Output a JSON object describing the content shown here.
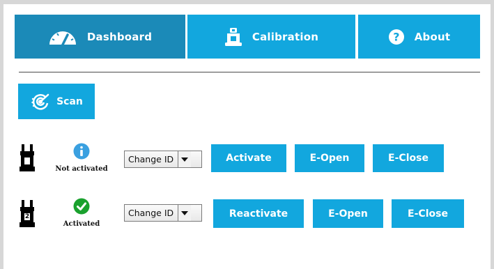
{
  "tabs": [
    {
      "label": "Dashboard",
      "icon": "gauge-icon",
      "active": true
    },
    {
      "label": "Calibration",
      "icon": "calibration-icon",
      "active": false
    },
    {
      "label": "About",
      "icon": "help-icon",
      "active": false
    }
  ],
  "scan": {
    "label": "Scan",
    "icon": "radar-icon"
  },
  "grippers": [
    {
      "id_badge": "1",
      "status_icon": "info-icon",
      "status_label": "Not activated",
      "change_id": "Change ID",
      "actions": [
        "Activate",
        "E-Open",
        "E-Close"
      ]
    },
    {
      "id_badge": "2",
      "status_icon": "check-icon",
      "status_label": "Activated",
      "change_id": "Change ID",
      "actions": [
        "Reactivate",
        "E-Open",
        "E-Close"
      ]
    }
  ],
  "colors": {
    "tab_active": "#1b8ab8",
    "tab_idle": "#12a7de",
    "button": "#12a7de",
    "info": "#3aa0e0",
    "ok": "#1aa12e"
  }
}
